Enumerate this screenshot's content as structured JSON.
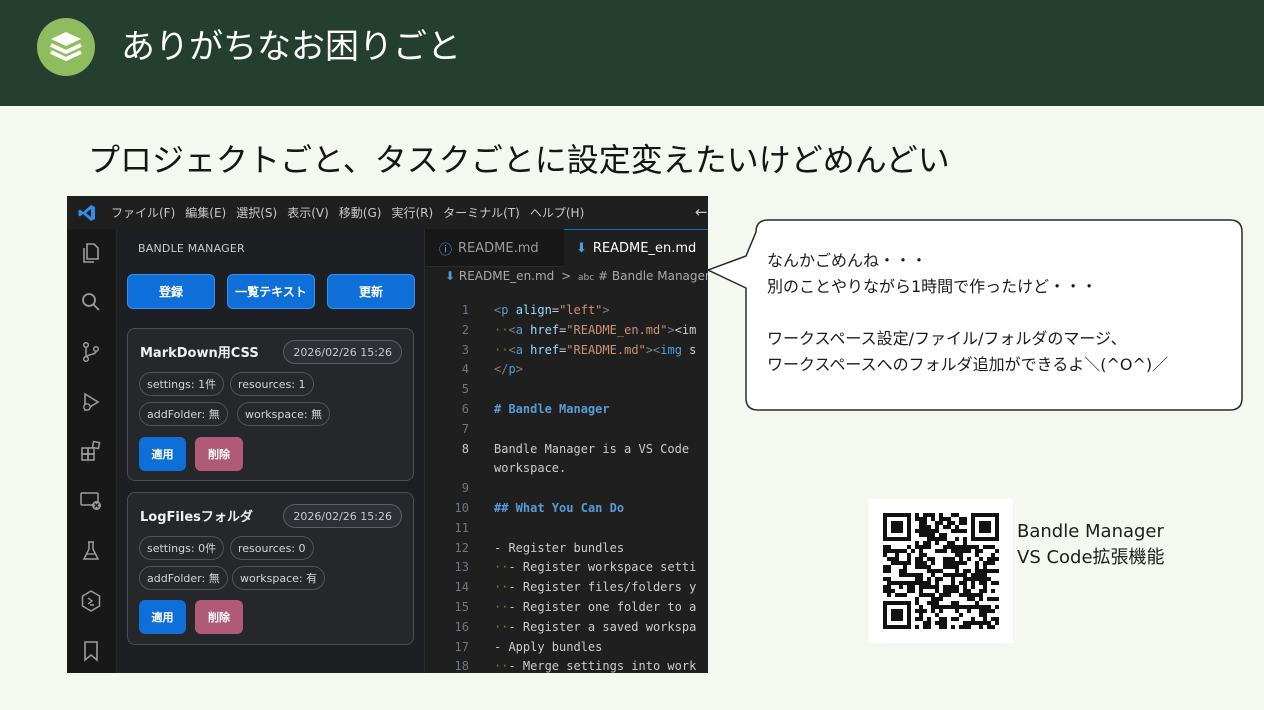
{
  "slide": {
    "title": "ありがちなお困りごと",
    "subtitle": "プロジェクトごと、タスクごとに設定変えたいけどめんどい"
  },
  "vscode": {
    "menu": [
      "ファイル(F)",
      "編集(E)",
      "選択(S)",
      "表示(V)",
      "移動(G)",
      "実行(R)",
      "ターミナル(T)",
      "ヘルプ(H)"
    ],
    "sidebar": {
      "title": "BANDLE MANAGER",
      "buttons": {
        "register": "登録",
        "list_text": "一覧テキスト",
        "refresh": "更新"
      },
      "cards": [
        {
          "name": "MarkDown用CSS",
          "date": "2026/02/26 15:26",
          "settings": "settings: 1件",
          "resources": "resources: 1",
          "add_folder": "addFolder: 無",
          "workspace": "workspace: 無",
          "apply": "適用",
          "delete": "削除"
        },
        {
          "name": "LogFilesフォルダ",
          "date": "2026/02/26 15:26",
          "settings": "settings: 0件",
          "resources": "resources: 0",
          "add_folder": "addFolder: 無",
          "workspace": "workspace: 有",
          "apply": "適用",
          "delete": "削除"
        }
      ]
    },
    "editor": {
      "tabs": [
        {
          "label": "README.md",
          "active": false
        },
        {
          "label": "README_en.md",
          "active": true
        }
      ],
      "breadcrumb": {
        "file": "README_en.md",
        "separator": ">",
        "section": "# Bandle Manager"
      },
      "lines": [
        {
          "n": "1",
          "text": "<p align=\"left\">"
        },
        {
          "n": "2",
          "text": "··<a href=\"README_en.md\"><im"
        },
        {
          "n": "3",
          "text": "··<a href=\"README.md\"><img s"
        },
        {
          "n": "4",
          "text": "</p>"
        },
        {
          "n": "5",
          "text": ""
        },
        {
          "n": "6",
          "text": "# Bandle Manager"
        },
        {
          "n": "7",
          "text": ""
        },
        {
          "n": "8",
          "text": "Bandle Manager is a VS Code"
        },
        {
          "n": "",
          "text": "workspace."
        },
        {
          "n": "9",
          "text": ""
        },
        {
          "n": "10",
          "text": "## What You Can Do"
        },
        {
          "n": "11",
          "text": ""
        },
        {
          "n": "12",
          "text": "- Register bundles"
        },
        {
          "n": "13",
          "text": "··- Register workspace setti"
        },
        {
          "n": "14",
          "text": "··- Register files/folders y"
        },
        {
          "n": "15",
          "text": "··- Register one folder to a"
        },
        {
          "n": "16",
          "text": "··- Register a saved workspa"
        },
        {
          "n": "17",
          "text": "- Apply bundles"
        },
        {
          "n": "18",
          "text": "··- Merge settings into work"
        }
      ]
    }
  },
  "bubble": {
    "lines": [
      "なんかごめんね・・・",
      "別のことやりながら1時間で作ったけど・・・",
      "",
      "ワークスペース設定/ファイル/フォルダのマージ、",
      "ワークスペースへのフォルダ追加ができるよ＼(^O^)／"
    ]
  },
  "qr": {
    "caption_line1": "Bandle Manager",
    "caption_line2": "VS Code拡張機能"
  },
  "colors": {
    "header_bg": "#243f30",
    "logo_green": "#8fbc5f",
    "vscode_blue": "#0e6fd8",
    "delete_pink": "#b05a78"
  }
}
